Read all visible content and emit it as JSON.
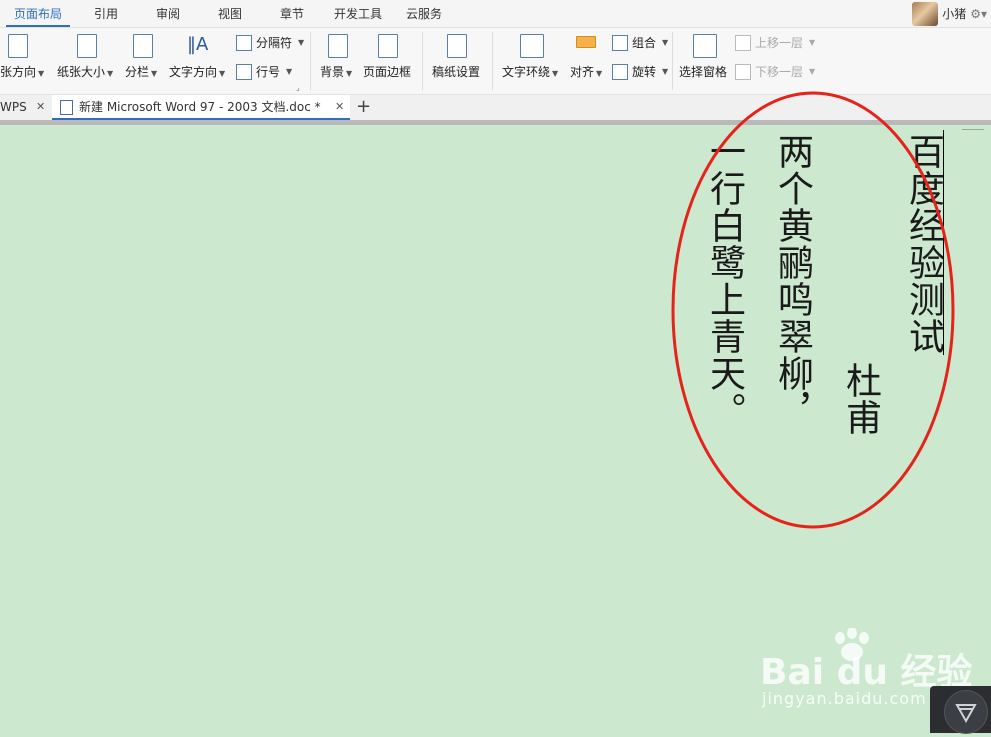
{
  "menu": {
    "tabs": [
      {
        "label": "页面布局",
        "active": true
      },
      {
        "label": "引用"
      },
      {
        "label": "审阅"
      },
      {
        "label": "视图"
      },
      {
        "label": "章节"
      },
      {
        "label": "开发工具"
      },
      {
        "label": "云服务"
      }
    ],
    "user_name": "小猪"
  },
  "ribbon": {
    "orientation": "张方向",
    "paper_size": "纸张大小",
    "columns": "分栏",
    "text_direction": "文字方向",
    "breaks": "分隔符",
    "line_numbers": "行号",
    "background": "背景",
    "page_border": "页面边框",
    "manuscript": "稿纸设置",
    "text_wrap": "文字环绕",
    "align": "对齐",
    "group": "组合",
    "rotate": "旋转",
    "selection_pane": "选择窗格",
    "bring_forward": "上移一层",
    "send_backward": "下移一层"
  },
  "tabs": {
    "wps": "WPS",
    "document": "新建 Microsoft Word 97 - 2003 文档.doc *"
  },
  "document": {
    "lines": [
      "百度经验测试",
      "杜甫",
      "两个黄鹂鸣翠柳，",
      "一行白鹭上青天。"
    ]
  },
  "watermark": {
    "logo": "Bai du 经验",
    "url": "jingyan.baidu.com"
  },
  "colors": {
    "page_background": "#cce8cf",
    "annotation": "#e5231b",
    "accent": "#2c6fbf"
  }
}
